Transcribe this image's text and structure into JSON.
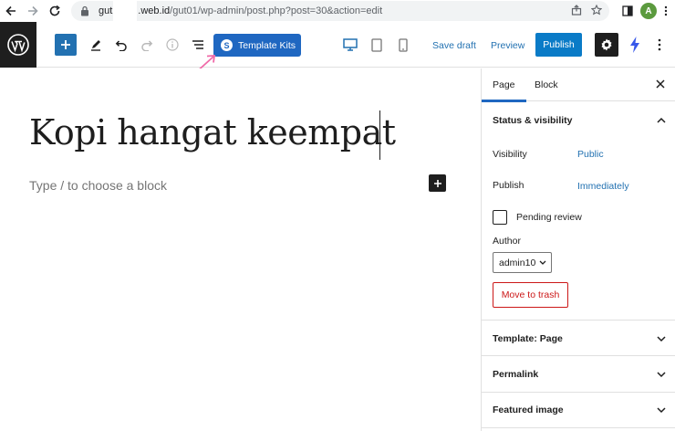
{
  "browser": {
    "url_start": "gut",
    "url_host_end": ".web.id",
    "url_path": "/gut01/wp-admin/post.php?post=30&action=edit",
    "avatar_letter": "A"
  },
  "toolbar": {
    "template_kits_label": "Template Kits",
    "template_kits_icon": "S",
    "save_draft_label": "Save draft",
    "preview_label": "Preview",
    "publish_label": "Publish"
  },
  "editor": {
    "title": "Kopi hangat keempat",
    "block_placeholder": "Type / to choose a block"
  },
  "sidebar": {
    "tabs": [
      {
        "label": "Page",
        "active": true
      },
      {
        "label": "Block",
        "active": false
      }
    ],
    "status_panel": {
      "title": "Status & visibility",
      "visibility_label": "Visibility",
      "visibility_value": "Public",
      "publish_label": "Publish",
      "publish_value": "Immediately",
      "pending_review_label": "Pending review",
      "pending_review_checked": false,
      "author_label": "Author",
      "author_value": "admin10",
      "trash_label": "Move to trash"
    },
    "panels": [
      {
        "title": "Template: Page"
      },
      {
        "title": "Permalink"
      },
      {
        "title": "Featured image"
      }
    ]
  },
  "colors": {
    "accent": "#2271b1",
    "template_kits": "#1f67c1",
    "publish": "#0a7bc7",
    "danger": "#cc1818",
    "annotation_arrow": "#f06aa8"
  }
}
